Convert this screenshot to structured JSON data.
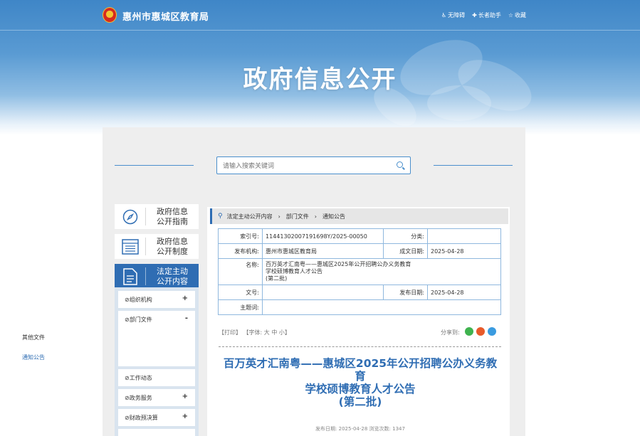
{
  "header": {
    "site_name": "惠州市惠城区教育局",
    "links": [
      {
        "icon": "accessibility-icon",
        "label": "无障碍"
      },
      {
        "icon": "elderly-assist-icon",
        "label": "长者助手"
      },
      {
        "icon": "star-icon",
        "label": "收藏"
      }
    ],
    "banner_title": "政府信息公开"
  },
  "search": {
    "placeholder": "请输入搜索关键词"
  },
  "sidebar": {
    "cards": [
      {
        "label_1": "政府信息",
        "label_2": "公开指南",
        "icon": "compass-icon"
      },
      {
        "label_1": "政府信息",
        "label_2": "公开制度",
        "icon": "list-icon"
      },
      {
        "label_1": "法定主动",
        "label_2": "公开内容",
        "icon": "document-icon"
      }
    ],
    "submenu": [
      {
        "label": "组织机构",
        "toggle": "+"
      },
      {
        "label": "部门文件",
        "toggle": "-"
      },
      {
        "label": "工作动态",
        "toggle": ""
      },
      {
        "label": "政务服务",
        "toggle": "+"
      },
      {
        "label": "财政预决算",
        "toggle": "+"
      }
    ],
    "sub_children": [
      "其他文件",
      "通知公告"
    ]
  },
  "breadcrumb": [
    "法定主动公开内容",
    "部门文件",
    "通知公告"
  ],
  "meta": {
    "index_label": "索引号:",
    "index_value": "11441302007191698Y/2025-00050",
    "category_label": "分类:",
    "category_value": "",
    "publisher_label": "发布机构:",
    "publisher_value": "惠州市惠城区教育局",
    "created_label": "成文日期:",
    "created_value": "2025-04-28",
    "name_label": "名称:",
    "name_line1": "百万英才汇南粤——惠城区2025年公开招聘公办义务教育",
    "name_line2": "学校硕博教育人才公告",
    "name_line3": "(第二批)",
    "docno_label": "文号:",
    "docno_value": "",
    "published_label": "发布日期:",
    "published_value": "2025-04-28",
    "topic_label": "主题词:",
    "topic_value": ""
  },
  "toolbar": {
    "print": "【打印】",
    "font_label": "【字体:",
    "font_large": "大",
    "font_medium": "中",
    "font_small": "小】",
    "share_label": "分享到:",
    "share_icons": [
      "wechat-icon",
      "weibo-icon",
      "qq-icon"
    ],
    "share_colors": [
      "#3fb34f",
      "#e85a2a",
      "#3a9be0"
    ]
  },
  "article": {
    "title_line1": "百万英才汇南粤——惠城区2025年公开招聘公办义务教",
    "title_line2": "育",
    "title_line3": "学校硕博教育人才公告",
    "title_line4": "(第二批)",
    "pubinfo": "发布日期: 2025-04-28   浏览次数: 1347"
  }
}
